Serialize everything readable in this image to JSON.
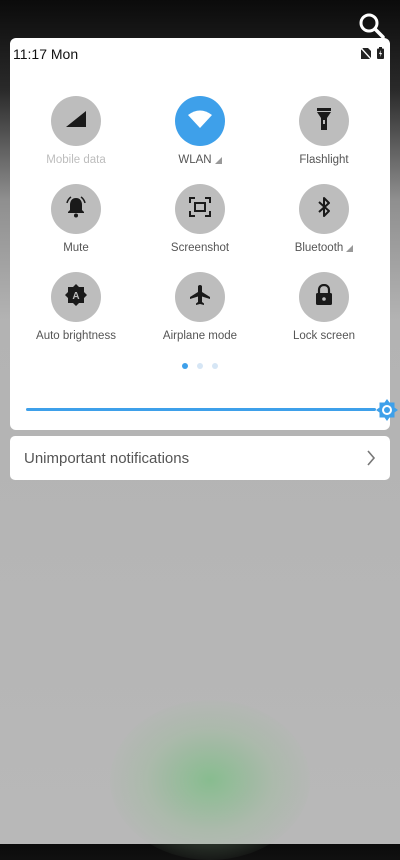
{
  "status_bar": {
    "time": "11:17 Mon",
    "icons": [
      "no-sim-icon",
      "battery-charging-icon"
    ]
  },
  "search": {
    "icon": "search-icon"
  },
  "quick_settings": {
    "tiles": [
      {
        "label": "Mobile data",
        "icon": "signal-icon",
        "active": false,
        "dimmed": true,
        "has_more": false
      },
      {
        "label": "WLAN",
        "icon": "wifi-icon",
        "active": true,
        "dimmed": false,
        "has_more": true
      },
      {
        "label": "Flashlight",
        "icon": "flashlight-icon",
        "active": false,
        "dimmed": false,
        "has_more": false
      },
      {
        "label": "Mute",
        "icon": "bell-icon",
        "active": false,
        "dimmed": false,
        "has_more": false
      },
      {
        "label": "Screenshot",
        "icon": "screenshot-icon",
        "active": false,
        "dimmed": false,
        "has_more": false
      },
      {
        "label": "Bluetooth",
        "icon": "bluetooth-icon",
        "active": false,
        "dimmed": false,
        "has_more": true
      },
      {
        "label": "Auto brightness",
        "icon": "auto-brightness-icon",
        "active": false,
        "dimmed": false,
        "has_more": false
      },
      {
        "label": "Airplane mode",
        "icon": "airplane-icon",
        "active": false,
        "dimmed": false,
        "has_more": false
      },
      {
        "label": "Lock screen",
        "icon": "lock-icon",
        "active": false,
        "dimmed": false,
        "has_more": false
      }
    ],
    "page_indicator": {
      "pages": 3,
      "current": 1
    }
  },
  "brightness": {
    "level_percent": 100,
    "icon": "brightness-sun-icon"
  },
  "colors": {
    "accent": "#3ea0ea",
    "tile_inactive": "#bdbdbd"
  },
  "notification": {
    "label": "Unimportant notifications",
    "icon": "chevron-right-icon"
  }
}
